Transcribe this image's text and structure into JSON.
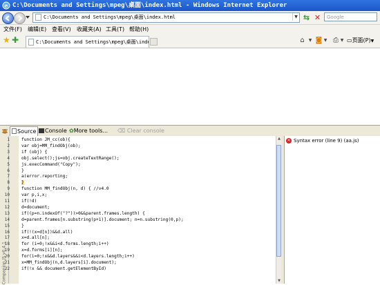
{
  "window": {
    "title": "C:\\Documents and Settings\\mpeg\\桌面\\index.html - Windows Internet Explorer",
    "icon": "ie-icon"
  },
  "address_bar": {
    "url": "C:\\Documents and Settings\\mpeg\\桌面\\index.html",
    "search_placeholder": "Google"
  },
  "menu": {
    "items": [
      "文件(F)",
      "编辑(E)",
      "查看(V)",
      "收藏夹(A)",
      "工具(T)",
      "帮助(H)"
    ]
  },
  "tabs": {
    "active_label": "C:\\Documents and Settings\\mpeg\\桌面\\index...",
    "page_menu": "页面(P)"
  },
  "firebug": {
    "toolbar": {
      "source": "Source",
      "console": "Console",
      "more_tools": "More tools...",
      "clear_console": "Clear console"
    },
    "side_label": "Companion.JS v0.4.1",
    "error": "Syntax error (line 9) (aa.js)",
    "lines": [
      {
        "n": "1",
        "text": "function JM_cc(ob){"
      },
      {
        "n": "2",
        "text": "var obj=MM_findObj(ob);"
      },
      {
        "n": "3",
        "text": "if (obj) {"
      },
      {
        "n": "4",
        "text": "obj.select();js=obj.createTextRange();"
      },
      {
        "n": "5",
        "text": "js.execCommand(\"Copy\");"
      },
      {
        "n": "6",
        "text": "}"
      },
      {
        "n": "7",
        "text": "a(error.reporting;"
      },
      {
        "n": "8",
        "text": "}"
      },
      {
        "n": "9",
        "text": "function MM_findObj(n, d) { //v4.0"
      },
      {
        "n": "10",
        "text": "var p,i,x;"
      },
      {
        "n": "11",
        "text": "if(!d)"
      },
      {
        "n": "12",
        "text": "d=document;"
      },
      {
        "n": "13",
        "text": "if((p=n.indexOf(\"?\"))>0&&parent.frames.length) {"
      },
      {
        "n": "14",
        "text": "d=parent.frames[n.substring(p+1)].document; n=n.substring(0,p);"
      },
      {
        "n": "15",
        "text": "}"
      },
      {
        "n": "16",
        "text": "if(!(x=d[n])&&d.all)"
      },
      {
        "n": "17",
        "text": "x=d.all[n];"
      },
      {
        "n": "18",
        "text": "for (i=0;!x&&i<d.forms.length;i++)"
      },
      {
        "n": "19",
        "text": "x=d.forms[i][n];"
      },
      {
        "n": "20",
        "text": "for(i=0;!x&&d.layers&&i<d.layers.length;i++)"
      },
      {
        "n": "21",
        "text": "x=MM_findObj(n,d.layers[i].document);"
      },
      {
        "n": "22",
        "text": "if(!x && document.getElementById)"
      }
    ]
  }
}
